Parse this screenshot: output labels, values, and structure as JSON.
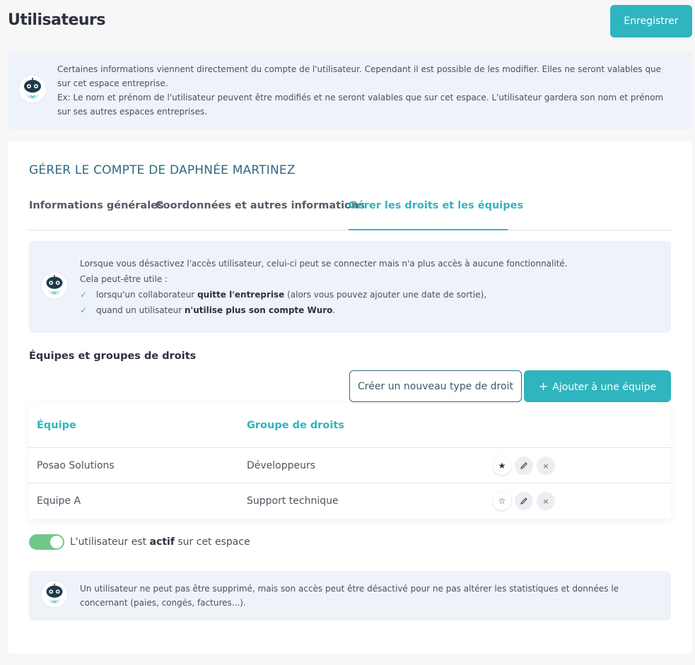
{
  "header": {
    "title": "Utilisateurs",
    "save_label": "Enregistrer"
  },
  "top_notice": {
    "line1": "Certaines informations viennent directement du compte de l'utilisateur. Cependant il est possible de les modifier. Elles ne seront valables que sur cet espace entreprise.",
    "line2": "Ex: Le nom et prénom de l'utilisateur peuvent être modifiés et ne seront valables que sur cet espace. L'utilisateur gardera son nom et prénom sur ses autres espaces entreprises."
  },
  "account": {
    "title": "GÉRER LE COMPTE DE DAPHNÉE MARTINEZ",
    "tabs": [
      {
        "label": "Informations générales",
        "active": false
      },
      {
        "label": "Coordonnées et autres informations",
        "active": false
      },
      {
        "label": "Gérer les droits et les équipes",
        "active": true
      }
    ]
  },
  "access_notice": {
    "line1": "Lorsque vous désactivez l'accès utilisateur, celui-ci peut se connecter mais n'a plus accès à aucune fonctionnalité.",
    "line2": "Cela peut-être utile :",
    "bullet1_pre": "lorsqu'un collaborateur ",
    "bullet1_bold": "quitte l'entreprise",
    "bullet1_post": " (alors vous pouvez ajouter une date de sortie),",
    "bullet2_pre": "quand un utilisateur ",
    "bullet2_bold": "n'utilise plus son compte Wuro",
    "bullet2_post": "."
  },
  "teams": {
    "section_title": "Équipes et groupes de droits",
    "create_right_label": "Créer un nouveau type de droit",
    "add_team_label": "Ajouter à une équipe",
    "add_team_icon": "plus-icon",
    "columns": [
      "Équipe",
      "Groupe de droits"
    ],
    "rows": [
      {
        "team": "Posao Solutions",
        "group": "Développeurs",
        "favorite": true
      },
      {
        "team": "Equipe A",
        "group": "Support technique",
        "favorite": false
      }
    ]
  },
  "active_toggle": {
    "on": true,
    "pre": "L'utilisateur est ",
    "bold": "actif",
    "post": " sur cet espace"
  },
  "bottom_notice": {
    "text": "Un utilisateur ne peut pas être supprimé, mais son accès peut être désactivé pour ne pas altérer les statistiques et données le concernant (paies, congés, factures...)."
  },
  "colors": {
    "accent": "#2fb5bf",
    "title_dark_teal": "#2b6b7f",
    "toggle_on": "#6fc88a",
    "notice_bg": "#eef2f9"
  }
}
